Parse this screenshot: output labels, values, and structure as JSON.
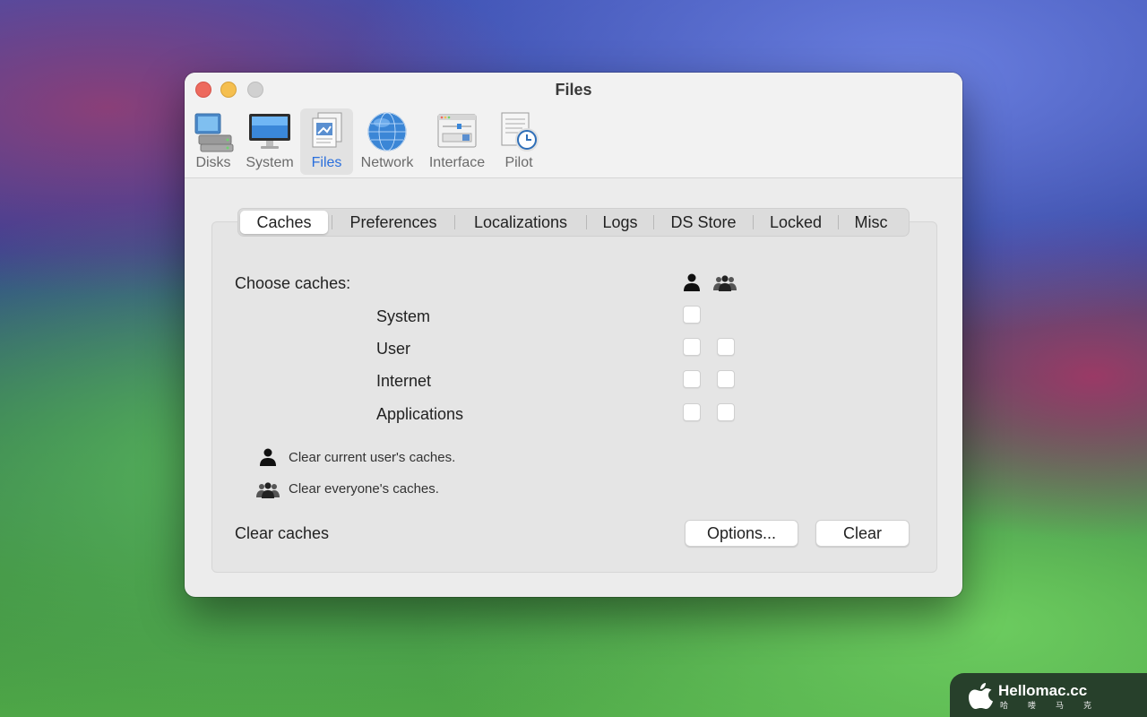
{
  "window": {
    "title": "Files",
    "toolbar": [
      {
        "label": "Disks",
        "icon": "disk-icon"
      },
      {
        "label": "System",
        "icon": "monitor-icon"
      },
      {
        "label": "Files",
        "icon": "files-icon",
        "active": true
      },
      {
        "label": "Network",
        "icon": "globe-icon"
      },
      {
        "label": "Interface",
        "icon": "interface-icon"
      },
      {
        "label": "Pilot",
        "icon": "pilot-clock-icon"
      }
    ]
  },
  "tabs": [
    "Caches",
    "Preferences",
    "Localizations",
    "Logs",
    "DS Store",
    "Locked",
    "Misc"
  ],
  "active_tab": "Caches",
  "caches": {
    "choose_label": "Choose caches:",
    "column_icons": [
      "single-user-icon",
      "group-users-icon"
    ],
    "rows": [
      {
        "label": "System",
        "user_checked": false,
        "all_checked": null
      },
      {
        "label": "User",
        "user_checked": false,
        "all_checked": false
      },
      {
        "label": "Internet",
        "user_checked": false,
        "all_checked": false
      },
      {
        "label": "Applications",
        "user_checked": false,
        "all_checked": false
      }
    ],
    "legend_user": "Clear current user's caches.",
    "legend_all": "Clear everyone's caches.",
    "clear_caches_label": "Clear caches",
    "options_button": "Options...",
    "clear_button": "Clear"
  },
  "watermark": {
    "title": "Hellomac.cc",
    "subtitle": "哈喽马克"
  },
  "colors": {
    "accent": "#2a6fdc",
    "close": "#ed6a5e",
    "minimize": "#f5bf4f",
    "zoom_disabled": "#d0d0d0"
  }
}
